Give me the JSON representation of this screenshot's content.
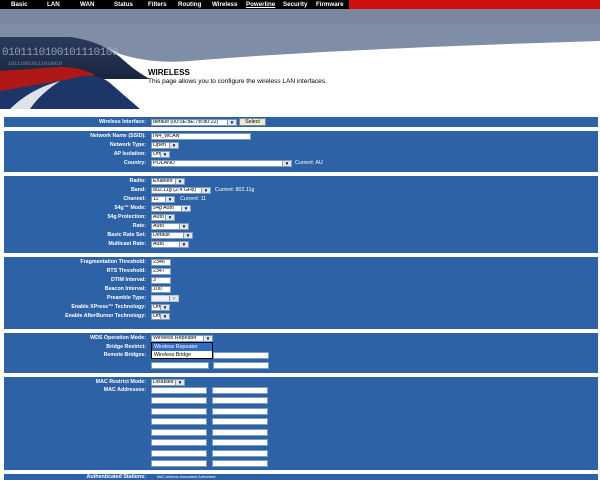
{
  "nav": {
    "items": [
      "Basic",
      "LAN",
      "WAN",
      "Status",
      "Filters",
      "Routing",
      "Wireless",
      "Powerline",
      "Security",
      "Firmware"
    ],
    "active": "Powerline"
  },
  "banner": {
    "binary_text": "0101110100101110100",
    "binary_small": "101110010111010010"
  },
  "page": {
    "title": "WIRELESS",
    "description": "This page allows you to configure the wireless LAN interfaces."
  },
  "interface": {
    "label": "Wireless Interface:",
    "value": "default (00:0E:8E:7B:80:22)",
    "select_button": "Select"
  },
  "network": {
    "ssid_label": "Network Name (SSID):",
    "ssid_value": "IN4_WLAN",
    "type_label": "Network Type:",
    "type_value": "Open",
    "isolation_label": "AP Isolation:",
    "isolation_value": "Off",
    "country_label": "Country:",
    "country_value": "POLAND",
    "country_current": "Current: AU"
  },
  "radio": {
    "radio_label": "Radio:",
    "radio_value": "Enabled",
    "band_label": "Band:",
    "band_value": "802.11g (2.4 GHz)",
    "band_current": "Current: 802.11g",
    "channel_label": "Channel:",
    "channel_value": "11",
    "channel_current": "Current: 11",
    "mode_label": "54g™ Mode:",
    "mode_value": "54g Auto",
    "protection_label": "54g Protection:",
    "protection_value": "Auto",
    "rate_label": "Rate:",
    "rate_value": "Auto",
    "basic_rate_label": "Basic Rate Set:",
    "basic_rate_value": "Default",
    "multicast_label": "Multicast Rate:",
    "multicast_value": "Auto"
  },
  "advanced": {
    "frag_label": "Fragmentation Threshold:",
    "frag_value": "2346",
    "rts_label": "RTS Threshold:",
    "rts_value": "2347",
    "dtim_label": "DTIM Interval:",
    "dtim_value": "3",
    "beacon_label": "Beacon Interval:",
    "beacon_value": "100",
    "preamble_label": "Preamble Type:",
    "preamble_value": "",
    "xpress_label": "Enable XPress™ Technology:",
    "xpress_value": "Off",
    "afterburner_label": "Enable AfterBurner Technology:",
    "afterburner_value": "Off"
  },
  "wds": {
    "mode_label": "WDS Operation Mode:",
    "mode_value": "Wireless Repeater",
    "bridge_label": "Bridge Restrict:",
    "remote_label": "Remote Bridges:",
    "options": [
      "Wireless Repeater",
      "Wireless Bridge"
    ],
    "highlighted": "Wireless Repeater"
  },
  "mac": {
    "mode_label": "MAC Restrict Mode:",
    "mode_value": "Disabled",
    "addresses_label": "MAC Addresses:"
  },
  "stations": {
    "label": "Authenticated Stations:",
    "columns": [
      "MAC Address",
      "Associated",
      "Authorized"
    ]
  },
  "colors": {
    "section_bg": "#2e62a6",
    "nav_bg": "#000000",
    "nav_accent": "#d01010"
  }
}
